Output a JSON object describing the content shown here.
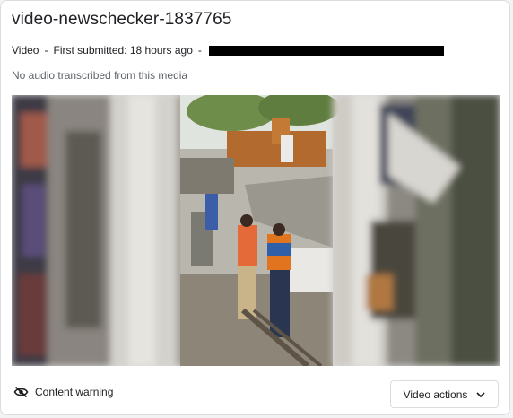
{
  "media_item": {
    "title": "video-newschecker-1837765",
    "type_label": "Video",
    "submitted_label": "First submitted: 18 hours ago",
    "separator": "-",
    "transcript_note": "No audio transcribed from this media"
  },
  "footer": {
    "content_warning_label": "Content warning",
    "content_warning_icon": "eye-off-icon",
    "video_actions_label": "Video actions",
    "video_actions_icon": "chevron-down-icon"
  }
}
